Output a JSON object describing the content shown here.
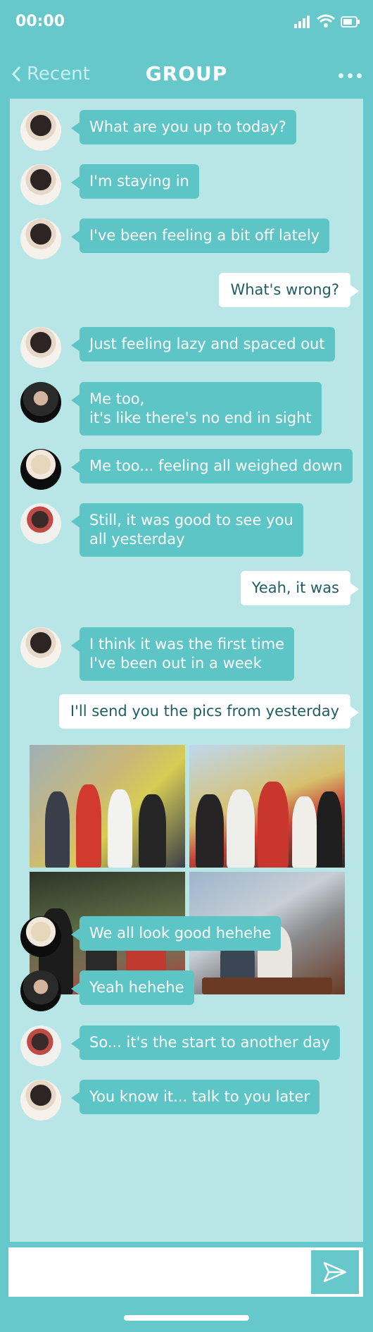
{
  "status_bar": {
    "time": "00:00",
    "icons": [
      "signal-icon",
      "wifi-icon",
      "battery-icon"
    ]
  },
  "header": {
    "back_label": "Recent",
    "title": "GROUP"
  },
  "messages": [
    {
      "side": "in",
      "text": "What are you up to today?"
    },
    {
      "side": "in",
      "text": "I'm staying in"
    },
    {
      "side": "in",
      "text": "I've been feeling a bit off lately"
    },
    {
      "side": "out",
      "text": "What's wrong?"
    },
    {
      "side": "in",
      "text": "Just feeling lazy and spaced out"
    },
    {
      "side": "in",
      "text": "Me too,\nit's like there's no end in sight"
    },
    {
      "side": "in",
      "text": "Me too... feeling all weighed down"
    },
    {
      "side": "in",
      "text": "Still, it was good to see you\nall yesterday"
    },
    {
      "side": "out",
      "text": "Yeah, it was"
    },
    {
      "side": "in",
      "text": "I think it was the first time\nI've been out in a week"
    },
    {
      "side": "out",
      "text": "I'll send you the pics from yesterday"
    },
    {
      "side": "in",
      "text": "We all look good hehehe"
    },
    {
      "side": "in",
      "text": "Yeah hehehe"
    },
    {
      "side": "in",
      "text": "So... it's the start to another day"
    },
    {
      "side": "in",
      "text": "You know it... talk to you later"
    }
  ],
  "composer": {
    "value": "",
    "send_icon": "send-icon"
  },
  "colors": {
    "background": "#66c8ca",
    "panel": "#b8e6e7",
    "incoming_bubble": "#5ec5c7",
    "outgoing_bubble": "#ffffff"
  }
}
